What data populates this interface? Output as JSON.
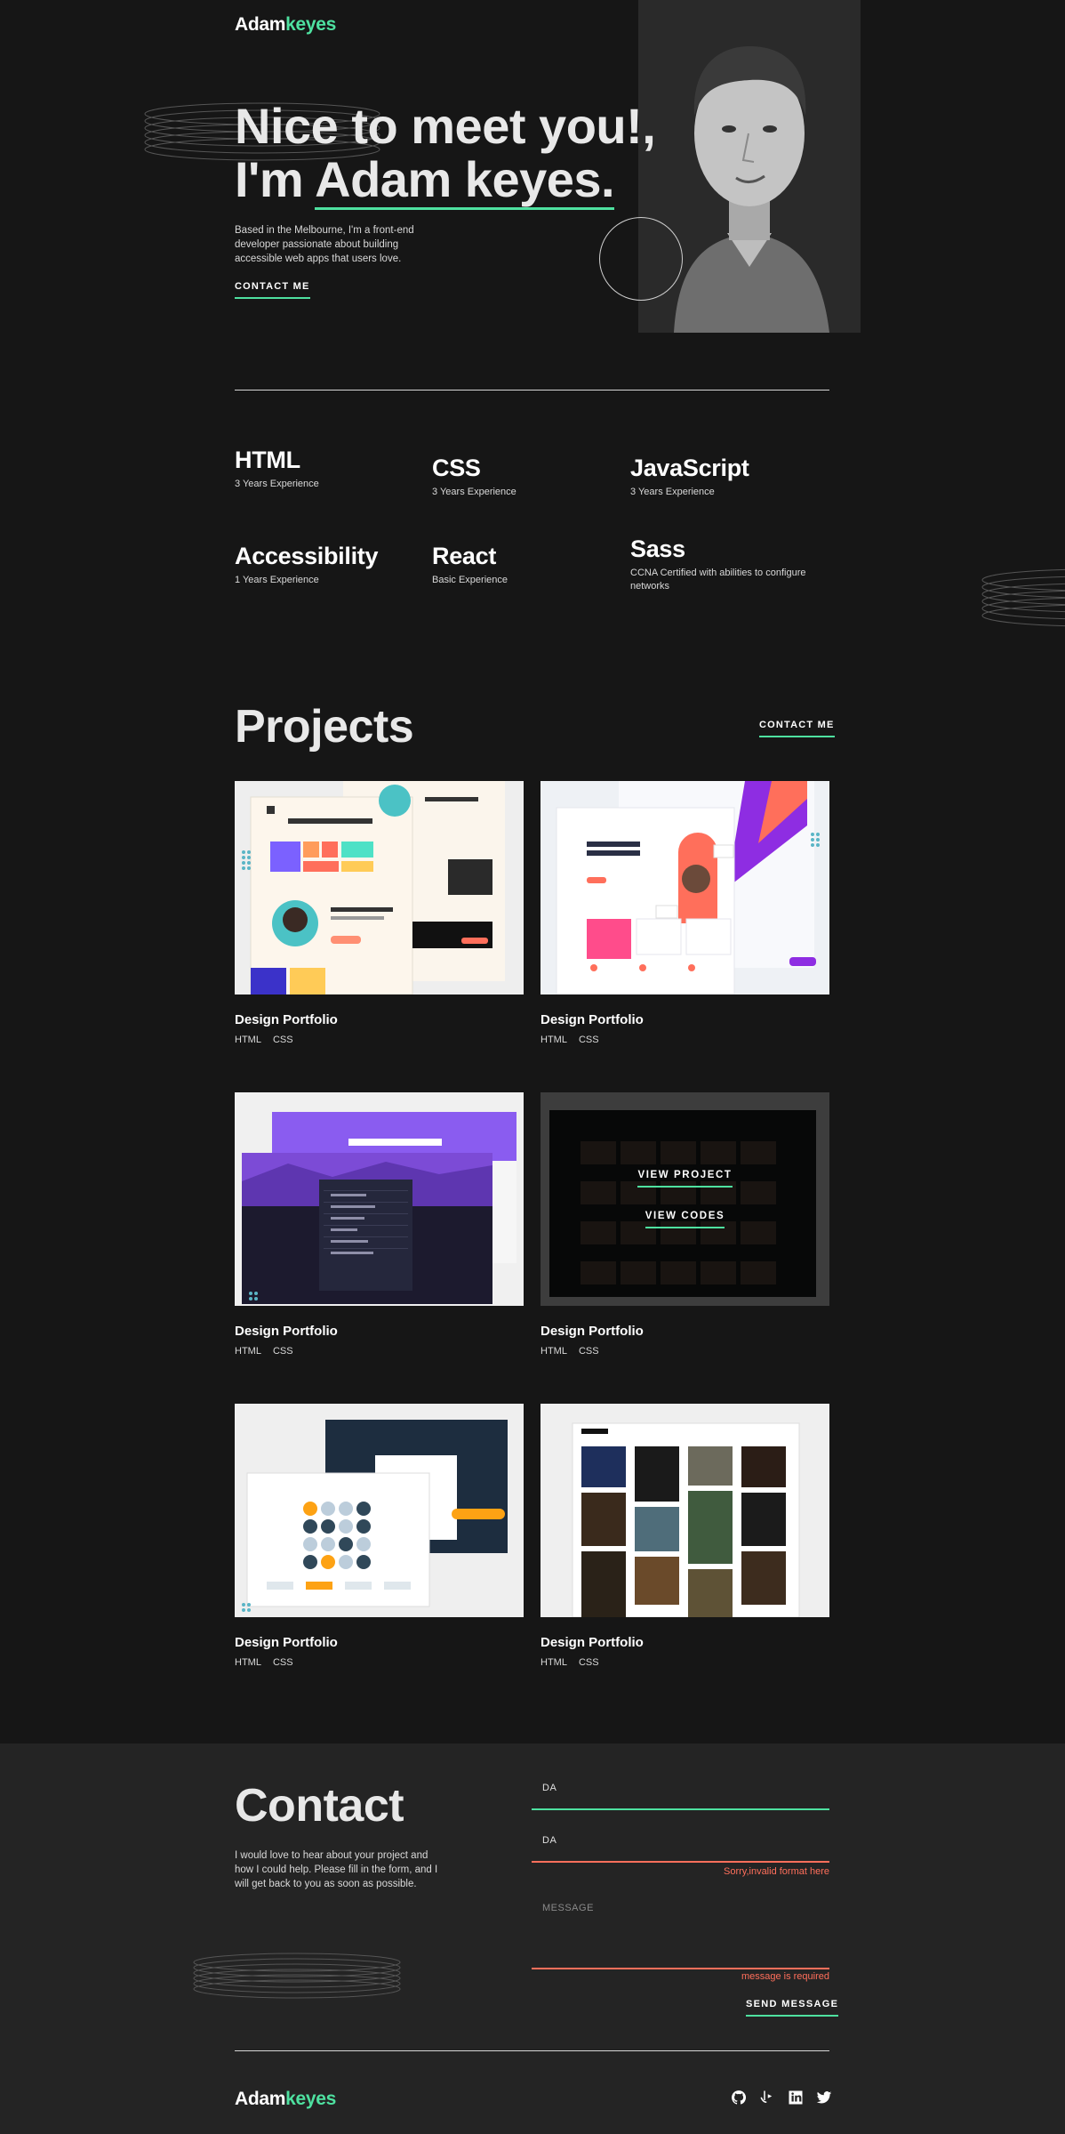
{
  "header": {
    "logo_first": "Adam",
    "logo_second": "keyes",
    "social_icons": [
      "github-icon",
      "frontend-mentor-icon",
      "linkedin-icon",
      "twitter-icon"
    ]
  },
  "hero": {
    "title_line1": "Nice to meet you!,",
    "title_prefix": "I'm ",
    "title_name": "Adam keyes.",
    "description": "Based in the Melbourne, I'm a front-end developer passionate about building accessible web apps that users love.",
    "cta": "CONTACT ME"
  },
  "skills": [
    {
      "name": "HTML",
      "detail": "3 Years Experience"
    },
    {
      "name": "CSS",
      "detail": "3 Years Experience"
    },
    {
      "name": "JavaScript",
      "detail": "3 Years Experience"
    },
    {
      "name": "Accessibility",
      "detail": "1 Years Experience"
    },
    {
      "name": "React",
      "detail": "Basic Experience"
    },
    {
      "name": "Sass",
      "detail": "CCNA Certified with abilities to configure networks"
    }
  ],
  "projects": {
    "title": "Projects",
    "cta": "CONTACT ME",
    "items": [
      {
        "title": "Design Portfolio",
        "tags": [
          "HTML",
          "CSS"
        ]
      },
      {
        "title": "Design Portfolio",
        "tags": [
          "HTML",
          "CSS"
        ]
      },
      {
        "title": "Design Portfolio",
        "tags": [
          "HTML",
          "CSS"
        ]
      },
      {
        "title": "Design Portfolio",
        "tags": [
          "HTML",
          "CSS"
        ]
      },
      {
        "title": "Design Portfolio",
        "tags": [
          "HTML",
          "CSS"
        ]
      },
      {
        "title": "Design Portfolio",
        "tags": [
          "HTML",
          "CSS"
        ]
      }
    ],
    "overlay": {
      "view_project": "VIEW PROJECT",
      "view_codes": "VIEW CODES"
    }
  },
  "contact": {
    "title": "Contact",
    "description": "I would love to hear about your project and how I could help. Please fill in the form, and I will get back to you as soon as possible.",
    "name_value": "DA",
    "email_value": "DA",
    "email_error": "Sorry,invalid format here",
    "message_placeholder": "MESSAGE",
    "message_error": "message is required",
    "submit": "SEND MESSAGE"
  },
  "footer": {
    "logo_first": "Adam",
    "logo_second": "keyes"
  },
  "colors": {
    "background": "#161616",
    "contact_background": "#242424",
    "accent": "#4ee1a0",
    "error": "#ff6f5b"
  }
}
